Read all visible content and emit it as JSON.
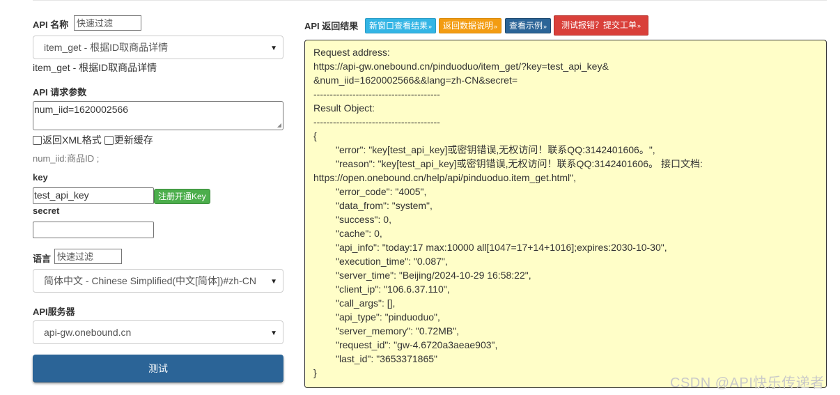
{
  "left": {
    "api_name_label": "API 名称",
    "api_filter_placeholder": "快速过滤",
    "api_select_value": "item_get - 根据ID取商品详情",
    "api_desc": "item_get - 根据ID取商品详情",
    "params_label": "API 请求参数",
    "params_value": "num_iid=1620002566",
    "xml_checkbox_label": "返回XML格式",
    "cache_checkbox_label": "更新缓存",
    "param_hint": "num_iid:商品ID ;",
    "key_label": "key",
    "key_value": "test_api_key",
    "register_key_button": "注册开通Key",
    "secret_label": "secret",
    "secret_value": "",
    "lang_label": "语言",
    "lang_filter_placeholder": "快速过滤",
    "lang_select_value": "简体中文 - Chinese Simplified(中文[简体])#zh-CN",
    "server_label": "API服务器",
    "server_select_value": "api-gw.onebound.cn",
    "test_button": "测试"
  },
  "right": {
    "title": "API 返回结果",
    "buttons": {
      "new_window": "新窗口查看结果",
      "data_desc": "返回数据说明",
      "example": "查看示例",
      "report": "测试报错？提交工单"
    },
    "result_lines": [
      "Request address:",
      "https://api-gw.onebound.cn/pinduoduo/item_get/?key=test_api_key&",
      "&num_iid=1620002566&&lang=zh-CN&secret=",
      "---------------------------------------",
      "Result Object:",
      "---------------------------------------",
      "{",
      "\"error\": \"key[test_api_key]或密钥错误,无权访问！联系QQ:3142401606。\",",
      "\"reason\": \"key[test_api_key]或密钥错误,无权访问！联系QQ:3142401606。 接口文档:",
      "https://open.onebound.cn/help/api/pinduoduo.item_get.html\",",
      "\"error_code\": \"4005\",",
      "\"data_from\": \"system\",",
      "\"success\": 0,",
      "\"cache\": 0,",
      "\"api_info\": \"today:17 max:10000 all[1047=17+14+1016];expires:2030-10-30\",",
      "\"execution_time\": \"0.087\",",
      "\"server_time\": \"Beijing/2024-10-29 16:58:22\",",
      "\"client_ip\": \"106.6.37.110\",",
      "\"call_args\": [],",
      "\"api_type\": \"pinduoduo\",",
      "\"server_memory\": \"0.72MB\",",
      "\"request_id\": \"gw-4.6720a3aeae903\",",
      "\"last_id\": \"3653371865\"",
      "}"
    ]
  },
  "watermark": "CSDN @API快乐传递者"
}
